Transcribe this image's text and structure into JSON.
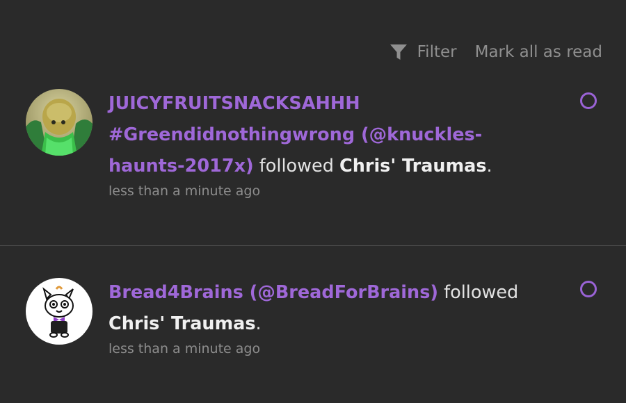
{
  "toolbar": {
    "filter_label": "Filter",
    "mark_all_read_label": "Mark all as read"
  },
  "notifications": [
    {
      "user_display": "JUICYFRUITSNACKSAHHH #Greendidnothingwrong (@knuckles-haunts-2017x)",
      "action": " followed ",
      "blog": "Chris' Traumas",
      "punct": ".",
      "time": "less than a minute ago"
    },
    {
      "user_display": "Bread4Brains (@BreadForBrains)",
      "action": " followed ",
      "blog": "Chris' Traumas",
      "punct": ".",
      "time": "less than a minute ago"
    }
  ],
  "colors": {
    "background": "#2a2a2a",
    "username": "#9f68d8",
    "unread_dot": "#9a63d6",
    "muted": "#8d8d8d"
  }
}
